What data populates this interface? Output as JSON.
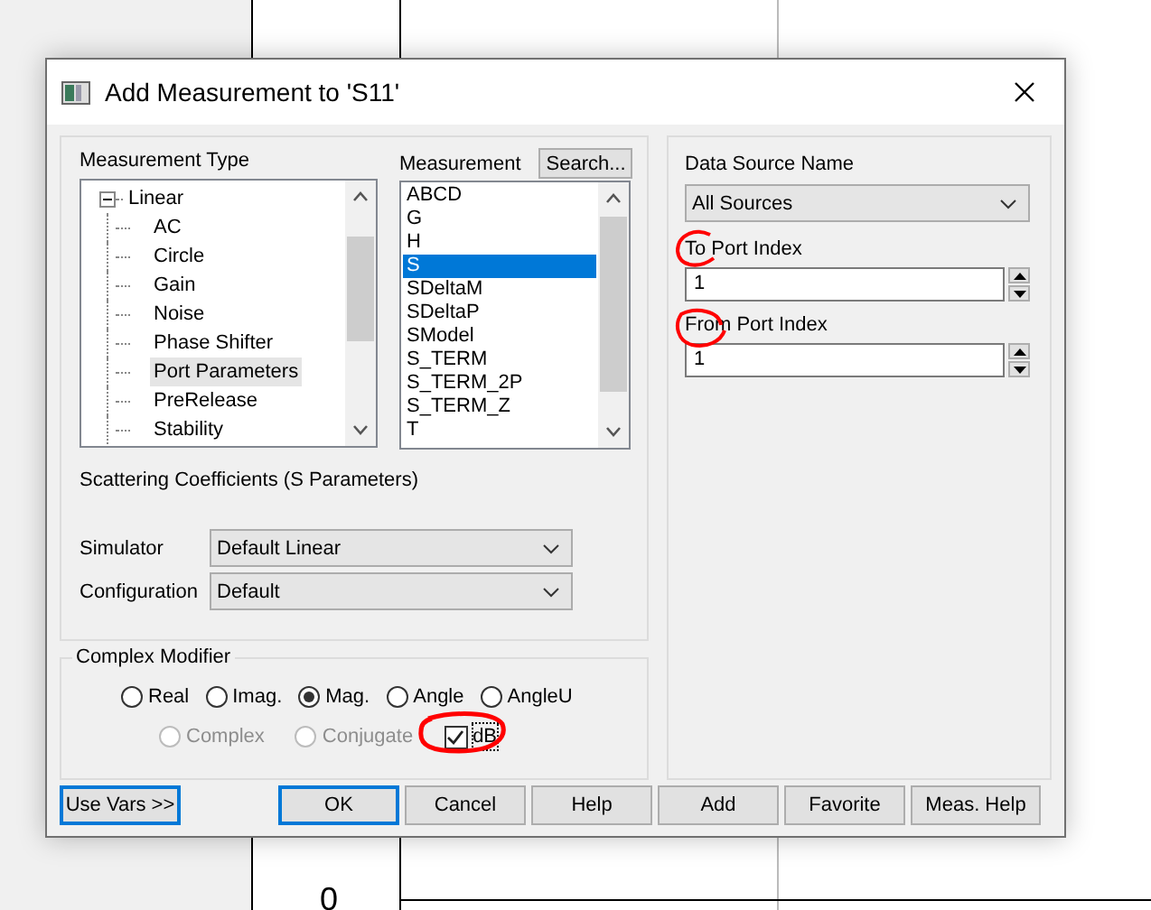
{
  "background": {
    "axis_label": "0"
  },
  "window": {
    "title": "Add Measurement to 'S11'"
  },
  "measurement_type": {
    "label": "Measurement Type",
    "tree": [
      {
        "label": "Linear",
        "expanded": true,
        "children": [
          {
            "label": "AC",
            "selected": false
          },
          {
            "label": "Circle",
            "selected": false
          },
          {
            "label": "Gain",
            "selected": false
          },
          {
            "label": "Noise",
            "selected": false
          },
          {
            "label": "Phase Shifter",
            "selected": false
          },
          {
            "label": "Port Parameters",
            "selected": true
          },
          {
            "label": "PreRelease",
            "selected": false
          },
          {
            "label": "Stability",
            "selected": false
          }
        ]
      }
    ]
  },
  "measurement": {
    "label": "Measurement",
    "search_button": "Search...",
    "items": [
      {
        "label": "ABCD",
        "selected": false
      },
      {
        "label": "G",
        "selected": false
      },
      {
        "label": "H",
        "selected": false
      },
      {
        "label": "S",
        "selected": true
      },
      {
        "label": "SDeltaM",
        "selected": false
      },
      {
        "label": "SDeltaP",
        "selected": false
      },
      {
        "label": "SModel",
        "selected": false
      },
      {
        "label": "S_TERM",
        "selected": false
      },
      {
        "label": "S_TERM_2P",
        "selected": false
      },
      {
        "label": "S_TERM_Z",
        "selected": false
      },
      {
        "label": "T",
        "selected": false
      }
    ]
  },
  "description": "Scattering Coefficients (S Parameters)",
  "selects": [
    {
      "label": "Simulator",
      "value": "Default Linear"
    },
    {
      "label": "Configuration",
      "value": "Default"
    }
  ],
  "complex_modifier": {
    "title": "Complex Modifier",
    "radios": [
      {
        "label": "Real",
        "selected": false,
        "disabled": false
      },
      {
        "label": "Imag.",
        "selected": false,
        "disabled": false
      },
      {
        "label": "Mag.",
        "selected": true,
        "disabled": false
      },
      {
        "label": "Angle",
        "selected": false,
        "disabled": false
      },
      {
        "label": "AngleU",
        "selected": false,
        "disabled": false
      }
    ],
    "row2": [
      {
        "kind": "radio",
        "label": "Complex",
        "selected": false,
        "disabled": true
      },
      {
        "kind": "radio",
        "label": "Conjugate",
        "selected": false,
        "disabled": true
      },
      {
        "kind": "checkbox",
        "label": "dB",
        "checked": true,
        "disabled": false
      }
    ]
  },
  "data_source": {
    "label": "Data Source Name",
    "value": "All Sources"
  },
  "ports": [
    {
      "label": "To Port Index",
      "value": "1"
    },
    {
      "label": "From Port Index",
      "value": "1"
    }
  ],
  "buttons": [
    {
      "label": "Use Vars >>",
      "focused": true
    },
    {
      "label": "OK",
      "focused": true
    },
    {
      "label": "Cancel",
      "focused": false
    },
    {
      "label": "Help",
      "focused": false
    },
    {
      "label": "Add",
      "focused": false
    },
    {
      "label": "Favorite",
      "focused": false
    },
    {
      "label": "Meas. Help",
      "focused": false
    }
  ]
}
